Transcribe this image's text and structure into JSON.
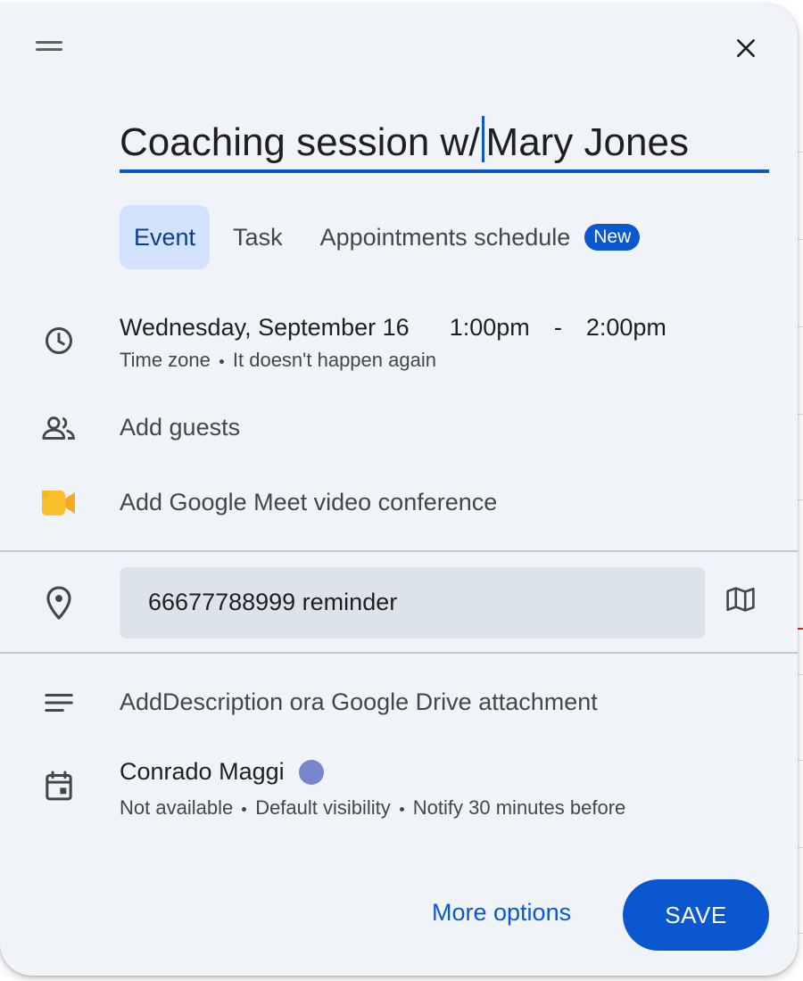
{
  "dialog": {
    "title": {
      "before_caret": "Coaching session w/",
      "after_caret": "Mary Jones"
    },
    "tabs": [
      {
        "label": "Event",
        "active": true
      },
      {
        "label": "Task",
        "active": false
      },
      {
        "label": "Appointments schedule",
        "active": false,
        "badge": "New"
      }
    ],
    "datetime": {
      "date": "Wednesday, September 16",
      "start": "1:00pm",
      "separator": "-",
      "end": "2:00pm",
      "timezone": "Time zone",
      "recurrence": "It doesn't happen again"
    },
    "guests": {
      "label": "Add guests"
    },
    "conference": {
      "label": "Add Google Meet video conference"
    },
    "location": {
      "value": "66677788999 reminder"
    },
    "description": {
      "label": "AddDescription ora Google Drive attachment"
    },
    "calendar": {
      "owner": "Conrado Maggi",
      "owner_color": "#7986cb",
      "availability": "Not available",
      "visibility": "Default visibility",
      "notification": "Notify 30 minutes before"
    },
    "footer": {
      "more_options": "More options",
      "save": "SAVE"
    }
  },
  "colors": {
    "accent": "#0b57d0",
    "surface": "#f0f4f9",
    "active_tab": "#d3e3fd",
    "location_field": "#dde3ea"
  },
  "icons": [
    "drag-handle-icon",
    "close-icon",
    "clock-icon",
    "guests-icon",
    "google-meet-icon",
    "location-pin-icon",
    "map-icon",
    "description-icon",
    "calendar-icon"
  ]
}
